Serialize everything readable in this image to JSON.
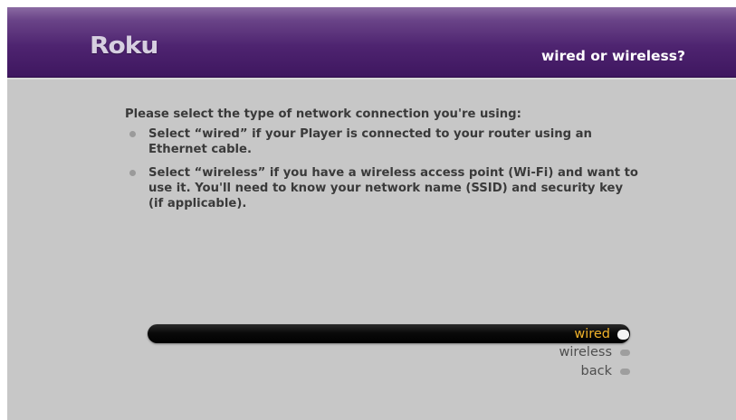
{
  "header": {
    "logo": "Roku",
    "title": "wired or wireless?"
  },
  "content": {
    "intro": "Please select the type of network connection you're using:",
    "bullets": [
      {
        "text": "Select “wired” if your Player is connected to your router using an Ethernet cable."
      },
      {
        "text": "Select “wireless” if you have a wireless access point (Wi-Fi) and want to use it. You'll need to know your network name (SSID) and security key (if applicable)."
      }
    ]
  },
  "menu": {
    "selected_index": 0,
    "items": [
      {
        "label": "wired"
      },
      {
        "label": "wireless"
      },
      {
        "label": "back"
      }
    ]
  },
  "colors": {
    "header_purple": "#4e2470",
    "panel_gray": "#c7c7c7",
    "selected_text": "#f0b22a",
    "unselected_text": "#4e4e4e",
    "body_text": "#3a3a3a"
  }
}
